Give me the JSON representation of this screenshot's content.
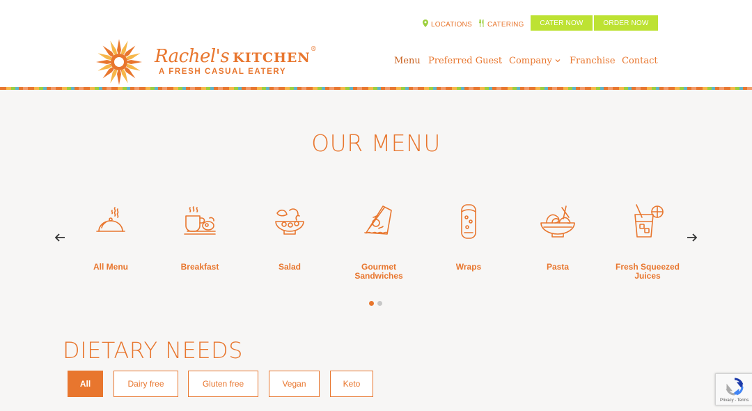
{
  "topbar": {
    "locations_label": "LOCATIONS",
    "catering_label": "CATERING",
    "cater_now_label": "CATER NOW",
    "order_now_label": "ORDER NOW",
    "accent_green": "#bde233"
  },
  "brand": {
    "name_script": "Rachel's",
    "name_caps": "KITCHEN",
    "registered": "®",
    "tagline": "A FRESH CASUAL EATERY",
    "color": "#e8762e"
  },
  "nav": {
    "items": [
      {
        "label": "Menu",
        "active": true
      },
      {
        "label": "Preferred Guest"
      },
      {
        "label": "Company",
        "has_dropdown": true
      },
      {
        "label": "Franchise"
      },
      {
        "label": "Contact"
      }
    ]
  },
  "menu": {
    "heading": "OUR MENU",
    "categories": [
      {
        "label": "All Menu",
        "icon": "cloche-icon"
      },
      {
        "label": "Breakfast",
        "icon": "breakfast-icon"
      },
      {
        "label": "Salad",
        "icon": "salad-icon"
      },
      {
        "label": "Gourmet Sandwiches",
        "icon": "sandwich-icon"
      },
      {
        "label": "Wraps",
        "icon": "wrap-icon"
      },
      {
        "label": "Pasta",
        "icon": "pasta-icon"
      },
      {
        "label": "Fresh Squeezed Juices",
        "icon": "juice-icon"
      }
    ],
    "prev_icon": "arrow-left-icon",
    "next_icon": "arrow-right-icon",
    "pagination": {
      "pages": 2,
      "active": 1
    }
  },
  "dietary": {
    "heading": "DIETARY NEEDS",
    "filters": [
      {
        "label": "All",
        "active": true
      },
      {
        "label": "Dairy free"
      },
      {
        "label": "Gluten free"
      },
      {
        "label": "Vegan"
      },
      {
        "label": "Keto"
      }
    ]
  },
  "recaptcha": {
    "text": "Privacy - Terms"
  }
}
